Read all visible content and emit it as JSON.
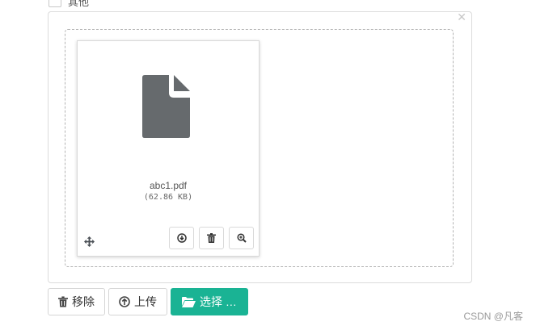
{
  "top_checkbox": {
    "label": "其他"
  },
  "file": {
    "name": "abc1.pdf",
    "size": "(62.86 KB)"
  },
  "buttons": {
    "remove": "移除",
    "upload": "上传",
    "browse": "选择 …"
  },
  "icons": {
    "close": "close-icon",
    "file": "file-icon",
    "move": "move-icon",
    "download": "download-icon",
    "trash": "trash-icon",
    "zoom": "zoom-icon",
    "upload": "upload-icon",
    "folder": "folder-open-icon"
  },
  "colors": {
    "primary": "#1ab394",
    "file_icon": "#666a6d"
  },
  "watermark": "CSDN @凡客"
}
